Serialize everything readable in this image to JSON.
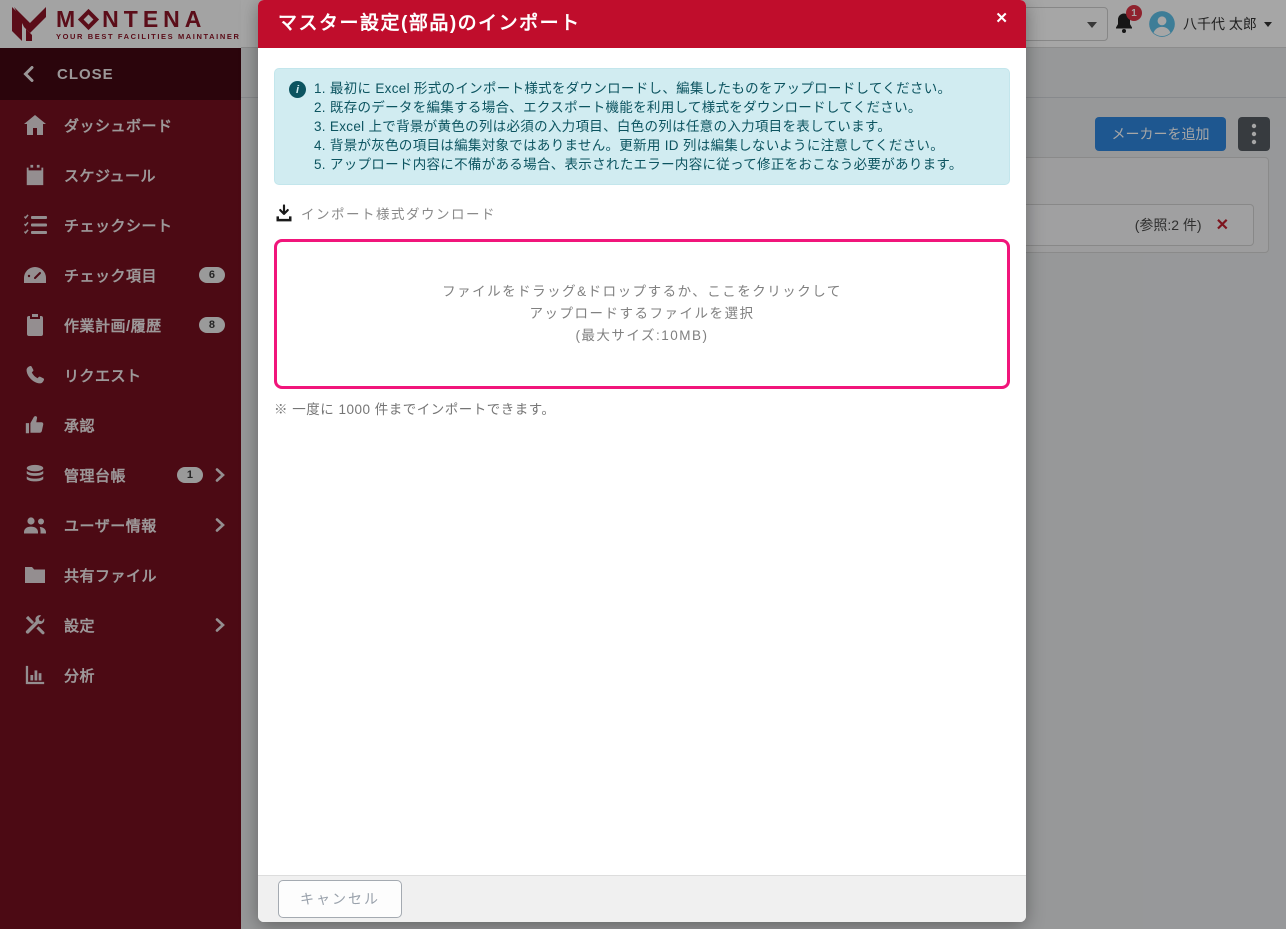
{
  "brand": {
    "name": "MONTENA",
    "name_part1": "M",
    "name_part2": "NTENA",
    "tagline": "YOUR BEST FACILITIES MAINTAINER"
  },
  "topbar": {
    "notification_count": "1",
    "user_name": "八千代 太郎"
  },
  "sidebar": {
    "close_label": "CLOSE",
    "items": [
      {
        "label": "ダッシュボード",
        "icon": "home-icon"
      },
      {
        "label": "スケジュール",
        "icon": "calendar-icon"
      },
      {
        "label": "チェックシート",
        "icon": "checklist-icon"
      },
      {
        "label": "チェック項目",
        "icon": "gauge-icon",
        "badge": "6"
      },
      {
        "label": "作業計画/履歴",
        "icon": "clipboard-icon",
        "badge": "8"
      },
      {
        "label": "リクエスト",
        "icon": "phone-icon"
      },
      {
        "label": "承認",
        "icon": "thumbs-up-icon"
      },
      {
        "label": "管理台帳",
        "icon": "database-icon",
        "badge": "1",
        "expandable": true
      },
      {
        "label": "ユーザー情報",
        "icon": "users-icon",
        "expandable": true
      },
      {
        "label": "共有ファイル",
        "icon": "folder-icon"
      },
      {
        "label": "設定",
        "icon": "tools-icon",
        "expandable": true
      },
      {
        "label": "分析",
        "icon": "bar-chart-icon"
      }
    ]
  },
  "background_page": {
    "add_maker_button": "メーカーを追加",
    "reference_text": "(参照:2 件)",
    "remove_glyph": "✕"
  },
  "modal": {
    "title": "マスター設定(部品)のインポート",
    "close_glyph": "✕",
    "info_icon_glyph": "i",
    "instructions": [
      "1. 最初に Excel 形式のインポート様式をダウンロードし、編集したものをアップロードしてください。",
      "2. 既存のデータを編集する場合、エクスポート機能を利用して様式をダウンロードしてください。",
      "3. Excel 上で背景が黄色の列は必須の入力項目、白色の列は任意の入力項目を表しています。",
      "4. 背景が灰色の項目は編集対象ではありません。更新用 ID 列は編集しないように注意してください。",
      "5. アップロード内容に不備がある場合、表示されたエラー内容に従って修正をおこなう必要があります。"
    ],
    "download_link": "インポート様式ダウンロード",
    "dropzone_lines": [
      "ファイルをドラッグ&ドロップするか、ここをクリックして",
      "アップロードするファイルを選択",
      "(最大サイズ:10MB)"
    ],
    "note": "※ 一度に 1000 件までインポートできます。",
    "cancel_label": "キャンセル"
  },
  "colors": {
    "sidebar_maroon": "#75101f",
    "sidebar_dark": "#420913",
    "modal_header_red": "#c00d2c",
    "dropzone_pink": "#f1157b",
    "info_bg": "#d1ecf1",
    "info_text": "#0c5460",
    "primary_blue": "#2e86de",
    "danger_red": "#dc3545"
  }
}
